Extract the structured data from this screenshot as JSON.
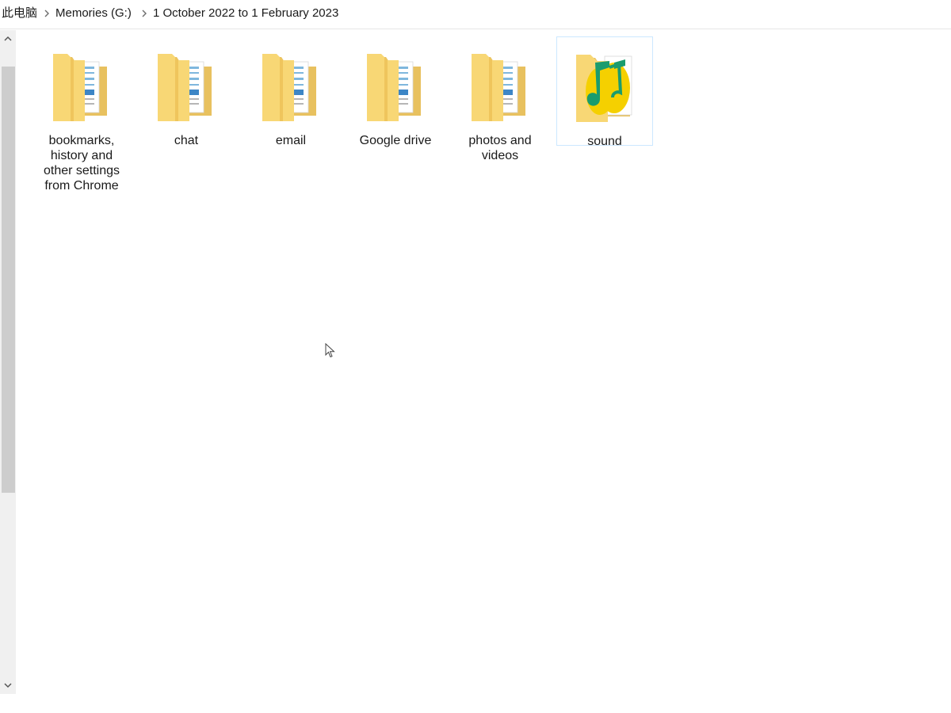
{
  "breadcrumb": {
    "items": [
      {
        "label": "此电脑"
      },
      {
        "label": "Memories (G:)"
      },
      {
        "label": "1 October 2022 to 1 February 2023"
      }
    ],
    "separator_icon": "chevron-right-icon"
  },
  "folders": [
    {
      "label": "bookmarks, history and other settings from Chrome",
      "icon": "folder-icon",
      "selected": false
    },
    {
      "label": "chat",
      "icon": "folder-icon",
      "selected": false
    },
    {
      "label": "email",
      "icon": "folder-icon",
      "selected": false
    },
    {
      "label": "Google drive",
      "icon": "folder-icon",
      "selected": false
    },
    {
      "label": "photos and videos",
      "icon": "folder-icon",
      "selected": false
    },
    {
      "label": "sound",
      "icon": "music-folder-icon",
      "selected": true
    }
  ],
  "scrollbar": {
    "up_icon": "chevron-up-icon",
    "down_icon": "chevron-down-icon"
  },
  "colors": {
    "folder_back": "#e8c15f",
    "folder_front": "#f8d775",
    "selection_border": "#cce8ff",
    "music_green": "#1a9c6e",
    "music_yellow": "#f5d000"
  }
}
